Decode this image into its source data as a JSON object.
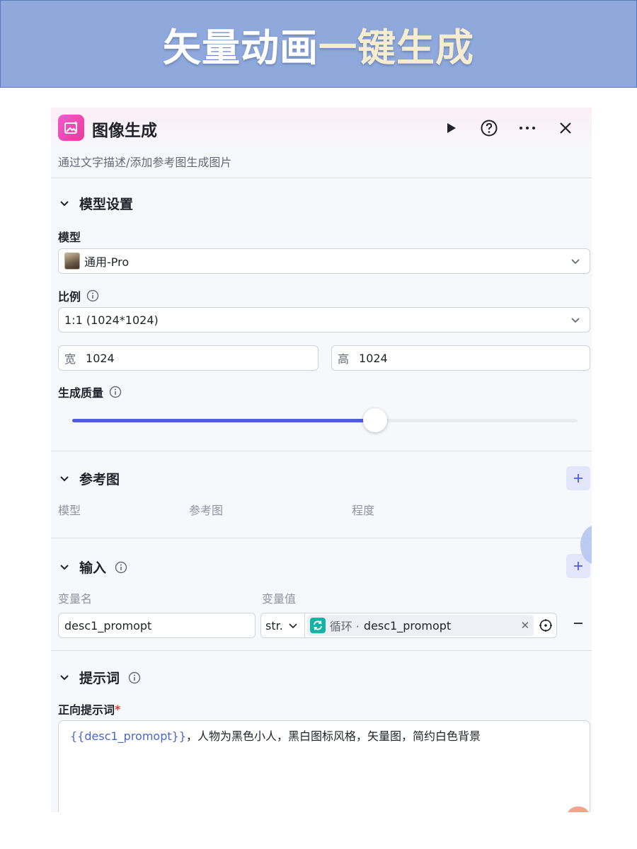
{
  "banner": {
    "title_part1": "矢量动画",
    "title_part2": "一键生成"
  },
  "node": {
    "title": "图像生成",
    "subtitle": "通过文字描述/添加参考图生成图片",
    "actions": [
      "play-icon",
      "help-icon",
      "more-icon",
      "close-icon"
    ]
  },
  "model_settings": {
    "section_title": "模型设置",
    "model_label": "模型",
    "model_value": "通用-Pro",
    "ratio_label": "比例",
    "ratio_value": "1:1 (1024*1024)",
    "width_prefix": "宽",
    "width_value": "1024",
    "height_prefix": "高",
    "height_value": "1024",
    "quality_label": "生成质量",
    "quality_level": 0.6
  },
  "reference": {
    "section_title": "参考图",
    "col_model": "模型",
    "col_image": "参考图",
    "col_degree": "程度"
  },
  "inputs": {
    "section_title": "输入",
    "col_name": "变量名",
    "col_value": "变量值",
    "rows": [
      {
        "name": "desc1_promopt",
        "type": "str.",
        "ref_node": "循环 ·",
        "ref_var": "desc1_promopt"
      }
    ]
  },
  "prompt": {
    "section_title": "提示词",
    "positive_label": "正向提示词",
    "required_mark": "*",
    "positive_var": "{{desc1_promopt}}",
    "positive_text": "，人物为黑色小人，黑白图标风格，矢量图，简约白色背景"
  },
  "colors": {
    "banner_bg": "#8fa9dc",
    "accent": "#4f5ddf",
    "node_icon": "#e53a9a",
    "loop_icon": "#14b3a3"
  }
}
